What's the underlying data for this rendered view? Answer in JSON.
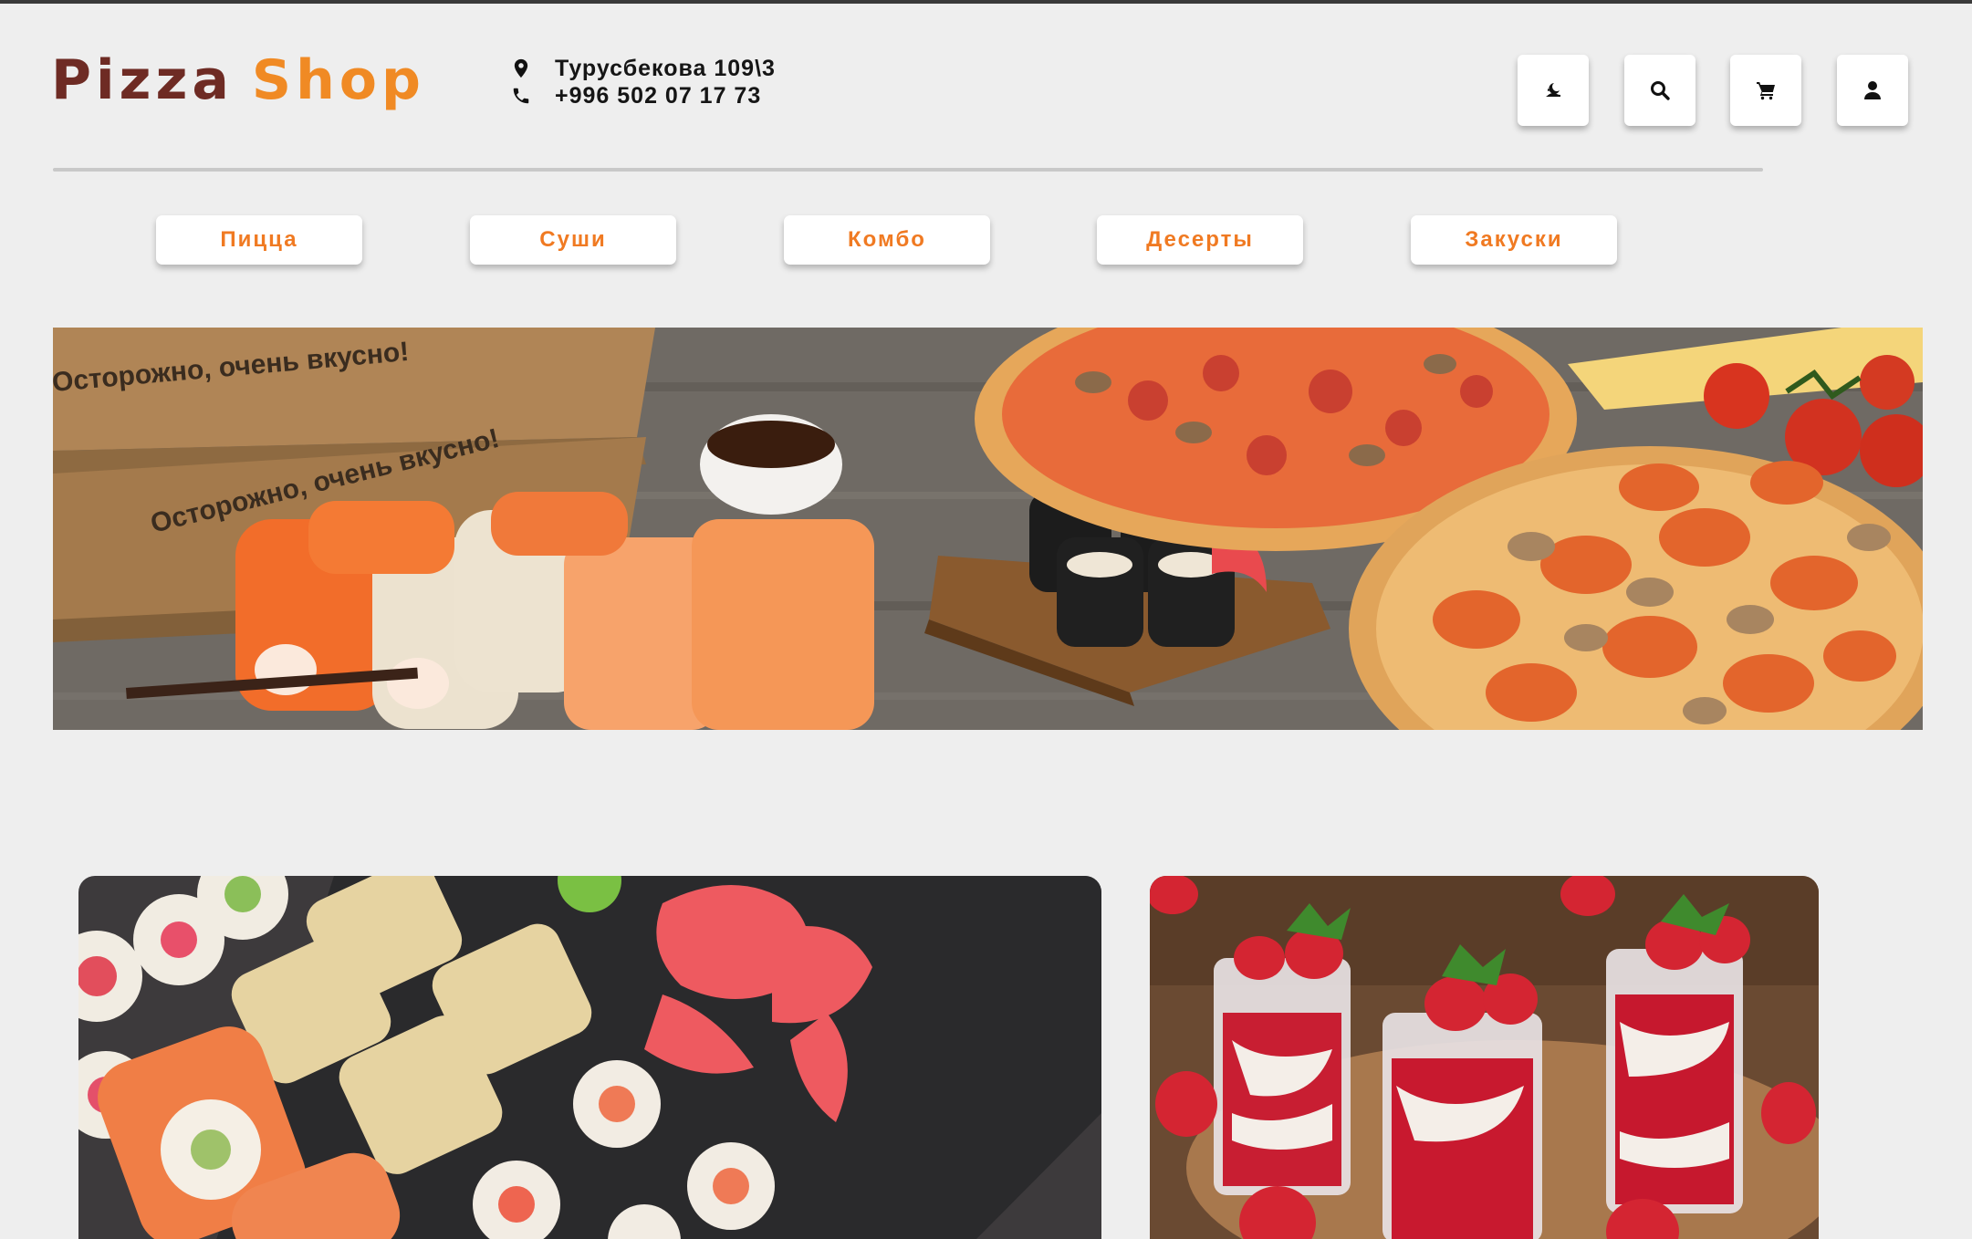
{
  "header": {
    "logo_part1": "Pizza",
    "logo_part2": "Shop",
    "address": "Турусбекова 109\\3",
    "phone": "+996 502 07 17 73"
  },
  "icons": {
    "address": "map-pin-icon",
    "phone": "phone-icon",
    "theme": "theme-toggle-icon",
    "search": "search-icon",
    "cart": "cart-icon",
    "user": "user-icon"
  },
  "nav": {
    "categories": [
      {
        "label": "Пицца"
      },
      {
        "label": "Суши"
      },
      {
        "label": "Комбо"
      },
      {
        "label": "Десерты"
      },
      {
        "label": "Закуски"
      }
    ]
  },
  "banner": {
    "box_text_1": "Осторожно, очень вкусно!",
    "box_text_2": "Осторожно, очень вкусно!"
  },
  "colors": {
    "logo_dark": "#6e2b24",
    "accent_orange": "#f08a24",
    "background": "#eeeeee"
  }
}
